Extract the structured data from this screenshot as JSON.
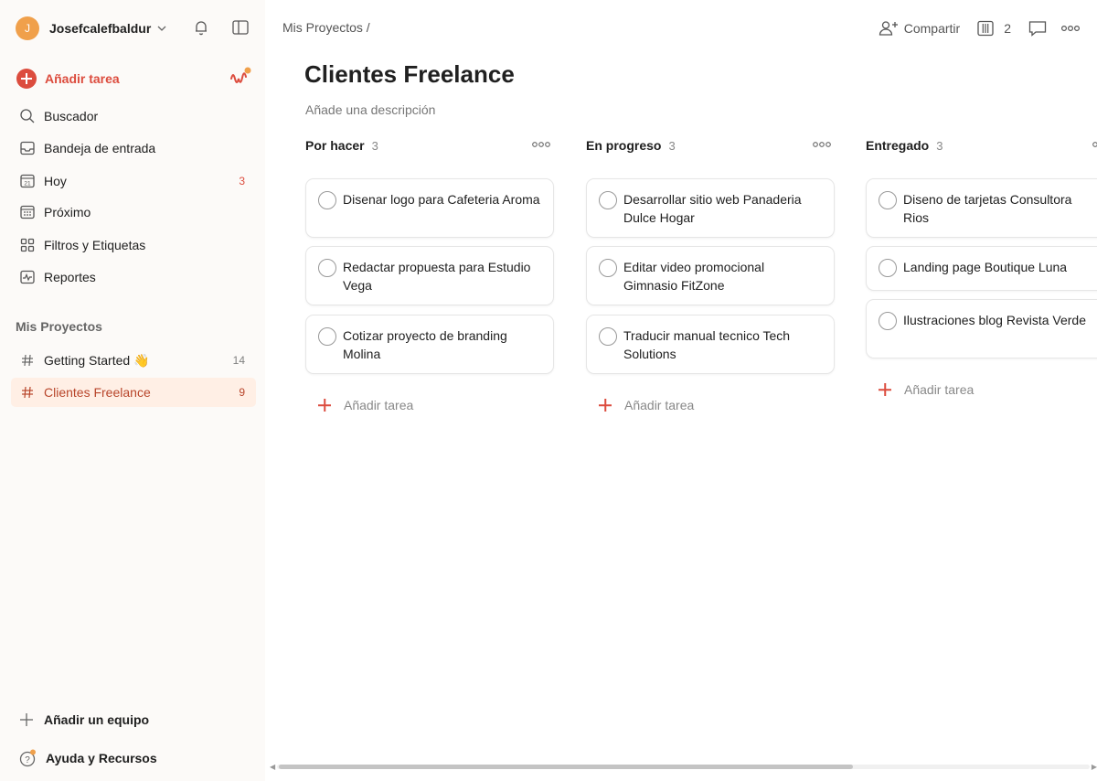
{
  "colors": {
    "accent": "#dc4c3e",
    "avatar": "#f0a04b",
    "active_bg": "#ffefe5"
  },
  "sidebar": {
    "user": {
      "initial": "J",
      "name": "Josefcalefbaldur"
    },
    "add_task": "Añadir tarea",
    "nav": [
      {
        "label": "Buscador",
        "icon": "search-icon"
      },
      {
        "label": "Bandeja de entrada",
        "icon": "inbox-icon"
      },
      {
        "label": "Hoy",
        "icon": "calendar-today-icon",
        "count": "3"
      },
      {
        "label": "Próximo",
        "icon": "calendar-upcoming-icon"
      },
      {
        "label": "Filtros y Etiquetas",
        "icon": "filters-icon"
      },
      {
        "label": "Reportes",
        "icon": "reports-icon"
      }
    ],
    "projects_title": "Mis Proyectos",
    "projects": [
      {
        "label": "Getting Started 👋",
        "count": "14"
      },
      {
        "label": "Clientes Freelance",
        "count": "9",
        "active": true
      }
    ],
    "add_team": "Añadir un equipo",
    "help": "Ayuda y Recursos"
  },
  "main": {
    "breadcrumb": "Mis Proyectos /",
    "share": "Compartir",
    "board_count": "2",
    "title": "Clientes Freelance",
    "description": "Añade una descripción",
    "add_task": "Añadir tarea",
    "columns": [
      {
        "title": "Por hacer",
        "count": "3",
        "tasks": [
          "Disenar logo para Cafeteria Aroma",
          "Redactar propuesta para Estudio Vega",
          "Cotizar proyecto de branding Molina"
        ]
      },
      {
        "title": "En progreso",
        "count": "3",
        "tasks": [
          "Desarrollar sitio web Panaderia Dulce Hogar",
          "Editar video promocional Gimnasio FitZone",
          "Traducir manual tecnico Tech Solutions"
        ]
      },
      {
        "title": "Entregado",
        "count": "3",
        "tasks": [
          "Diseno de tarjetas Consultora Rios",
          "Landing page Boutique Luna",
          "Ilustraciones blog Revista Verde"
        ]
      }
    ]
  }
}
